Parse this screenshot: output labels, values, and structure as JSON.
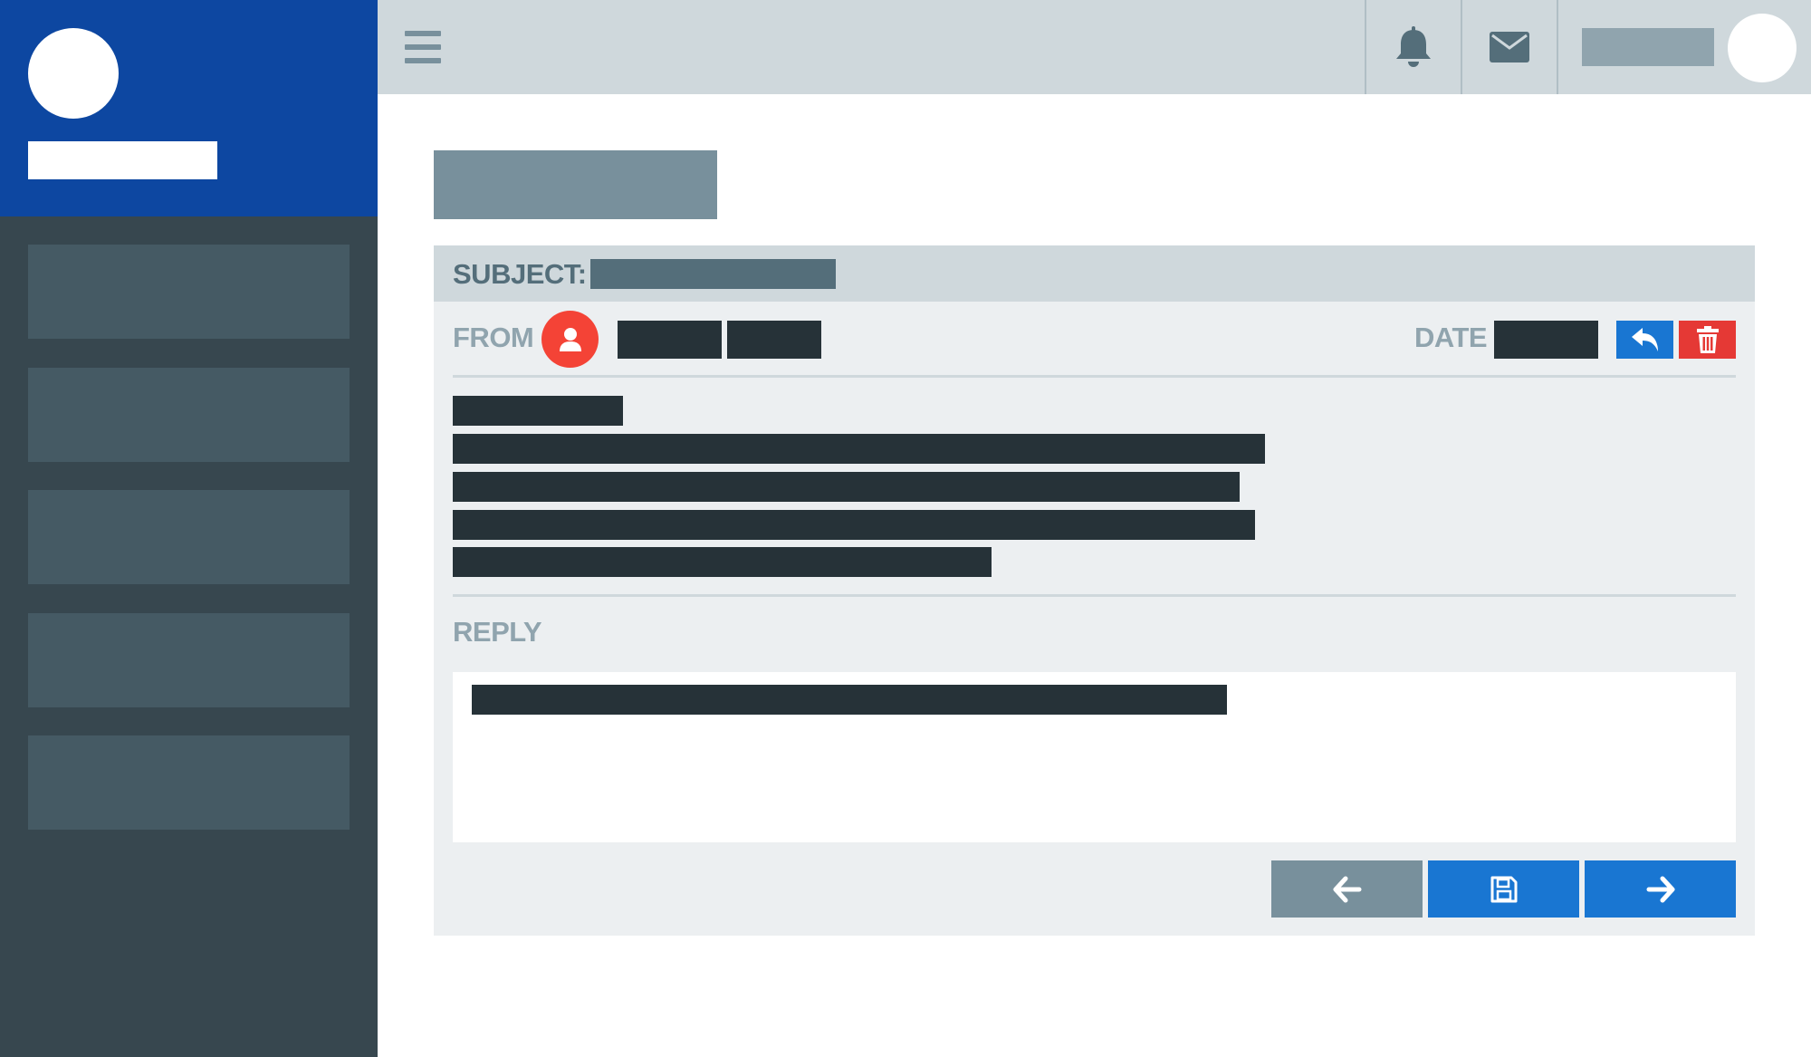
{
  "colors": {
    "brand": "#0d47a1",
    "sidebar": "#37474f",
    "sidebar_item": "#455a64",
    "topbar": "#cfd8dc",
    "accent_blue": "#1976d2",
    "danger_red": "#e53935",
    "sender_avatar": "#f44336",
    "muted": "#78909c"
  },
  "sidebar": {
    "items": [
      {
        "icon": "none"
      },
      {
        "icon": "none"
      },
      {
        "icon": "none"
      },
      {
        "icon": "none"
      },
      {
        "icon": "none"
      }
    ]
  },
  "topbar": {
    "menu_icon": "hamburger-menu-icon",
    "notifications_icon": "bell-icon",
    "messages_icon": "envelope-icon"
  },
  "message": {
    "subject_label": "SUBJECT:",
    "from_label": "FROM",
    "sender_icon": "user-icon",
    "date_label": "DATE",
    "reply_icon": "reply-arrow-icon",
    "delete_icon": "trash-icon",
    "reply_label": "REPLY"
  },
  "footer": {
    "prev_icon": "arrow-left-icon",
    "save_icon": "floppy-disk-icon",
    "next_icon": "arrow-right-icon"
  }
}
